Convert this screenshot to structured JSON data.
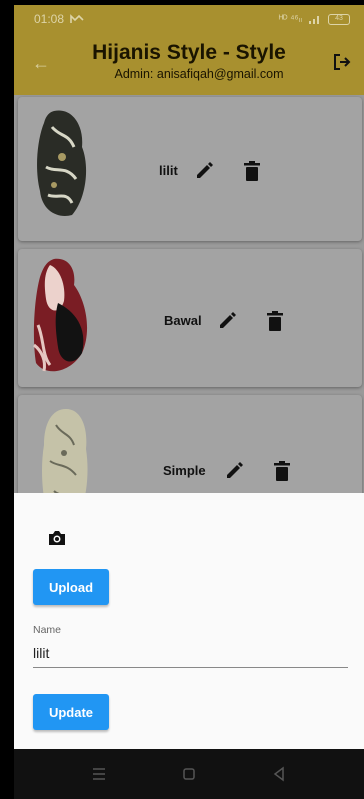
{
  "status_bar": {
    "time": "01:08",
    "notification_icon": "notification-icon",
    "signal_text": "ᴴᴰ ⁴⁶ₗₗ",
    "battery": "43"
  },
  "app_bar": {
    "title": "Hijanis Style - Style",
    "subtitle": "Admin: anisafiqah@gmail.com",
    "back_icon": "arrow-back-icon",
    "logout_icon": "logout-icon",
    "color": "#a8902f"
  },
  "items": [
    {
      "name": "lilit"
    },
    {
      "name": "Bawal"
    },
    {
      "name": "Simple"
    }
  ],
  "sheet": {
    "camera_icon": "camera-icon",
    "upload_label": "Upload",
    "name_label": "Name",
    "name_value": "lilit",
    "update_label": "Update",
    "accent": "#2196f3"
  },
  "nav_bar": {
    "icons": [
      "menu-icon",
      "home-icon",
      "back-icon"
    ]
  }
}
